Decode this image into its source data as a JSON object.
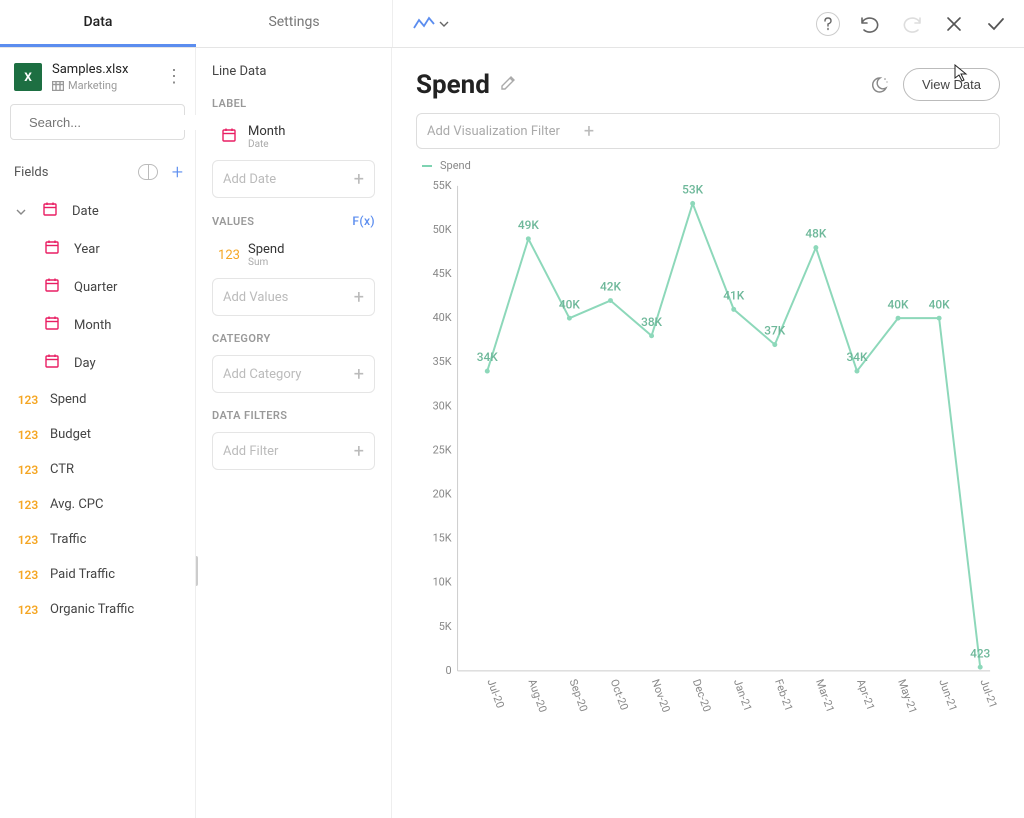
{
  "tabs": {
    "data": "Data",
    "settings": "Settings"
  },
  "file": {
    "name": "Samples.xlsx",
    "sheet": "Marketing"
  },
  "search": {
    "placeholder": "Search..."
  },
  "fields_header": "Fields",
  "fields": {
    "date": "Date",
    "year": "Year",
    "quarter": "Quarter",
    "month": "Month",
    "day": "Day",
    "spend": "Spend",
    "budget": "Budget",
    "ctr": "CTR",
    "avg_cpc": "Avg. CPC",
    "traffic": "Traffic",
    "paid_traffic": "Paid Traffic",
    "organic_traffic": "Organic Traffic"
  },
  "type_num": "123",
  "config": {
    "title": "Line Data",
    "label_hdr": "LABEL",
    "label_field": "Month",
    "label_sub": "Date",
    "add_date": "Add Date",
    "values_hdr": "VALUES",
    "fx": "F(x)",
    "value_field": "Spend",
    "value_sub": "Sum",
    "add_values": "Add Values",
    "category_hdr": "CATEGORY",
    "add_category": "Add Category",
    "filters_hdr": "DATA FILTERS",
    "add_filter": "Add Filter"
  },
  "chart": {
    "title": "Spend",
    "add_filter": "Add Visualization Filter",
    "view_data": "View Data",
    "legend": "Spend"
  },
  "chart_data": {
    "type": "line",
    "x": [
      "Jul-20",
      "Aug-20",
      "Sep-20",
      "Oct-20",
      "Nov-20",
      "Dec-20",
      "Jan-21",
      "Feb-21",
      "Mar-21",
      "Apr-21",
      "May-21",
      "Jun-21",
      "Jul-21"
    ],
    "values": [
      34000,
      49000,
      40000,
      42000,
      38000,
      53000,
      41000,
      37000,
      48000,
      34000,
      40000,
      40000,
      423
    ],
    "display_labels": [
      "34K",
      "49K",
      "40K",
      "42K",
      "38K",
      "53K",
      "41K",
      "37K",
      "48K",
      "34K",
      "40K",
      "40K",
      "423"
    ],
    "ylim": [
      0,
      55000
    ],
    "yticks": [
      0,
      5000,
      10000,
      15000,
      20000,
      25000,
      30000,
      35000,
      40000,
      45000,
      50000,
      55000
    ],
    "ytick_labels": [
      "0",
      "5K",
      "10K",
      "15K",
      "20K",
      "25K",
      "30K",
      "35K",
      "40K",
      "45K",
      "50K",
      "55K"
    ],
    "series_color": "#8dd8ba"
  }
}
